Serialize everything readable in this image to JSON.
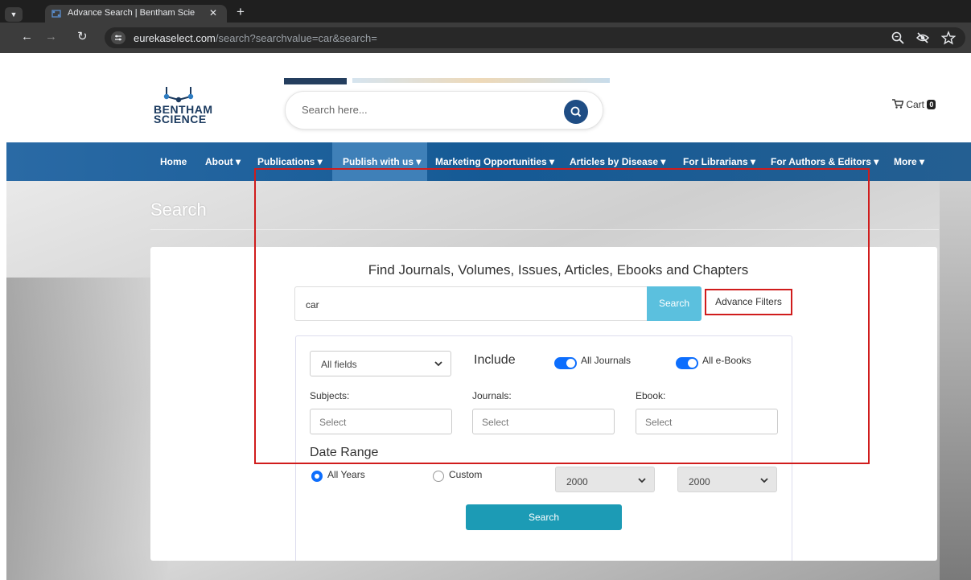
{
  "browser": {
    "tab_title": "Advance Search | Bentham Scie",
    "url_host": "eurekaselect.com",
    "url_path": "/search?searchvalue=car&search="
  },
  "header": {
    "logo_line1": "BENTHAM",
    "logo_line2": "SCIENCE",
    "search_placeholder": "Search here...",
    "cart_label": "Cart",
    "cart_count": "0"
  },
  "nav": {
    "items": [
      "Home",
      "About",
      "Publications",
      "Publish with us",
      "Marketing Opportunities",
      "Articles by Disease",
      "For Librarians",
      "For Authors & Editors",
      "More"
    ],
    "active": "Publish with us"
  },
  "page": {
    "heading": "Search",
    "card_title": "Find Journals, Volumes, Issues, Articles, Ebooks and Chapters",
    "query_value": "car",
    "search_button": "Search",
    "advance_filters": "Advance Filters",
    "field_select": "All fields",
    "include_label": "Include",
    "toggle_journals": "All Journals",
    "toggle_ebooks": "All e-Books",
    "subjects_label": "Subjects:",
    "journals_label": "Journals:",
    "ebook_label": "Ebook:",
    "select_placeholder": "Select",
    "date_range_label": "Date Range",
    "radio_all_years": "All Years",
    "radio_custom": "Custom",
    "year_from": "2000",
    "year_to": "2000",
    "submit_button": "Search"
  },
  "colors": {
    "nav_blue": "#155a95",
    "search_cyan": "#5bc0de",
    "submit_teal": "#1c9bb5",
    "toggle_blue": "#0d6efd",
    "annotation_red": "#d01c1c"
  }
}
